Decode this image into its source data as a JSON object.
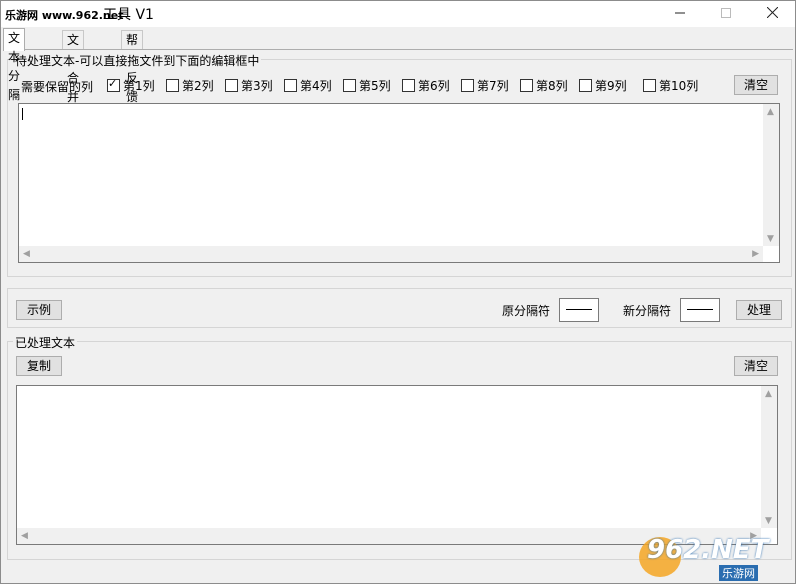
{
  "window": {
    "brand": "乐游网 www.962.net",
    "title": "工具 V1",
    "minimize_icon": "minimize-icon",
    "maximize_icon": "maximize-icon",
    "close_icon": "close-icon"
  },
  "tabs": [
    {
      "label": "文本分隔",
      "active": true
    },
    {
      "label": "文本合并",
      "active": false
    },
    {
      "label": "帮助反馈",
      "active": false
    }
  ],
  "input_group": {
    "label": "待处理文本-可以直接拖文件到下面的编辑框中",
    "keep_columns_label": "需要保留的列",
    "columns": [
      {
        "label": "第1列",
        "checked": true
      },
      {
        "label": "第2列",
        "checked": false
      },
      {
        "label": "第3列",
        "checked": false
      },
      {
        "label": "第4列",
        "checked": false
      },
      {
        "label": "第5列",
        "checked": false
      },
      {
        "label": "第6列",
        "checked": false
      },
      {
        "label": "第7列",
        "checked": false
      },
      {
        "label": "第8列",
        "checked": false
      },
      {
        "label": "第9列",
        "checked": false
      },
      {
        "label": "第10列",
        "checked": false
      }
    ],
    "clear_label": "清空",
    "text_value": ""
  },
  "action_bar": {
    "example_label": "示例",
    "orig_sep_label": "原分隔符",
    "orig_sep_value": "",
    "new_sep_label": "新分隔符",
    "new_sep_value": "",
    "process_label": "处理"
  },
  "output_group": {
    "label": "已处理文本",
    "copy_label": "复制",
    "clear_label": "清空",
    "text_value": ""
  },
  "watermark": {
    "logo_text": "962.NET",
    "sub_text": "乐游网",
    "accent": "#f5a623"
  }
}
